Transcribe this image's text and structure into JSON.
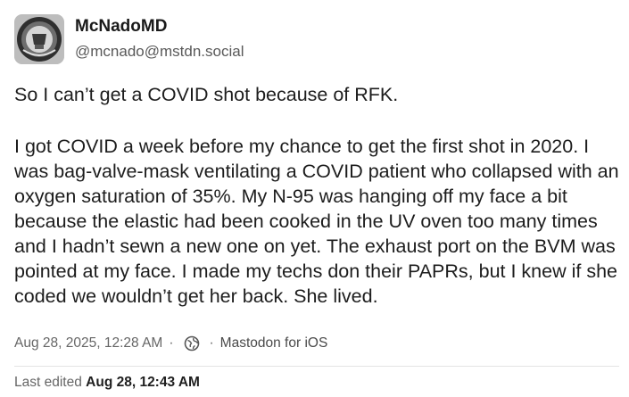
{
  "author": {
    "display_name": "McNadoMD",
    "handle": "@mcnado@mstdn.social",
    "avatar_icon": "badge-avatar-icon"
  },
  "post": {
    "paragraphs": [
      "So I can’t get a COVID shot because of RFK.",
      "I got COVID a week before my chance to get the first shot in 2020. I was bag-valve-mask ventilating a COVID patient who collapsed with an oxygen saturation of 35%. My N-95 was hanging off my face a bit because the elastic had been cooked in the UV oven too many times and I hadn’t sewn a new one on yet. The exhaust port on the BVM was pointed at my face. I made my techs don their PAPRs, but I knew if she coded we wouldn’t get her back. She lived."
    ]
  },
  "meta": {
    "timestamp": "Aug 28, 2025, 12:28 AM",
    "separator": "·",
    "visibility_icon": "globe-icon",
    "application": "Mastodon for iOS"
  },
  "edit": {
    "label": "Last edited",
    "time": "Aug 28, 12:43 AM"
  }
}
